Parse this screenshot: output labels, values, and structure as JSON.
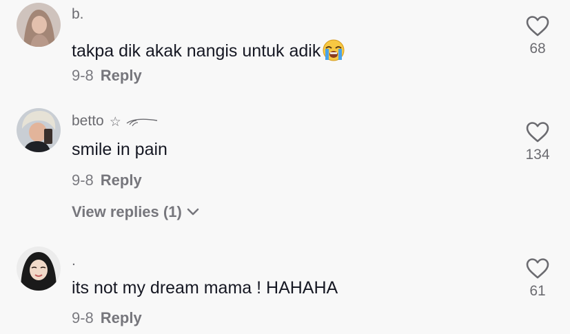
{
  "comments": [
    {
      "username": "b.",
      "text": "takpa dik akak nangis untuk adik",
      "emoji": "loudly-crying-face",
      "date": "9-8",
      "reply_label": "Reply",
      "likes": "68"
    },
    {
      "username": "betto",
      "username_decoration": "☆",
      "text": "smile in pain",
      "date": "9-8",
      "reply_label": "Reply",
      "likes": "134",
      "view_replies": "View replies (1)"
    },
    {
      "username": ".",
      "text": "its not my dream mama ! HAHAHA",
      "date": "9-8",
      "reply_label": "Reply",
      "likes": "61"
    }
  ],
  "icons": {
    "like": "heart-outline-icon",
    "expand": "chevron-down-icon",
    "emoji": "loudly-crying-face-emoji"
  },
  "colors": {
    "background": "#f8f8f8",
    "primary_text": "#161823",
    "secondary_text": "#6b6b70"
  }
}
